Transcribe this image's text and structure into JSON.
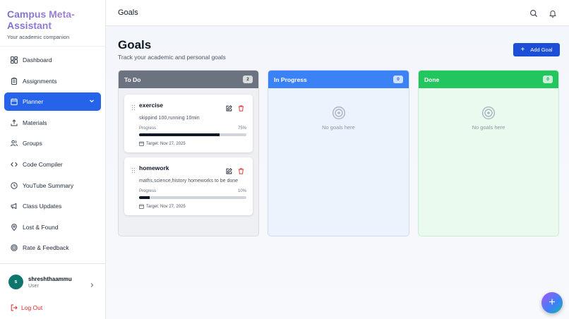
{
  "sidebar": {
    "brand_title": "Campus Meta-Assistant",
    "brand_sub": "Your academic companion",
    "items": [
      {
        "label": "Dashboard",
        "icon": "dashboard-icon"
      },
      {
        "label": "Assignments",
        "icon": "clipboard-icon"
      },
      {
        "label": "Planner",
        "icon": "calendar-icon",
        "active": true
      },
      {
        "label": "Materials",
        "icon": "upload-icon"
      },
      {
        "label": "Groups",
        "icon": "users-icon"
      },
      {
        "label": "Code Compiler",
        "icon": "code-icon"
      },
      {
        "label": "YouTube Summary",
        "icon": "clock-icon"
      },
      {
        "label": "Class Updates",
        "icon": "megaphone-icon"
      },
      {
        "label": "Lost & Found",
        "icon": "map-pin-icon"
      },
      {
        "label": "Rate & Feedback",
        "icon": "target-icon"
      }
    ],
    "user": {
      "initial": "s",
      "name": "shreshthaammu",
      "role": "User"
    },
    "logout_label": "Log Out"
  },
  "header": {
    "title": "Goals"
  },
  "main": {
    "title": "Goals",
    "subtitle": "Track your academic and personal goals",
    "add_button": "Add Goal"
  },
  "columns": {
    "todo": {
      "title": "To Do",
      "count": "2"
    },
    "progress": {
      "title": "In Progress",
      "count": "0",
      "empty": "No goals here"
    },
    "done": {
      "title": "Done",
      "count": "0",
      "empty": "No goals here"
    }
  },
  "goals": [
    {
      "title": "exercise",
      "description": "skippind 100,running 10min",
      "progress_label": "Progress",
      "progress_text": "75%",
      "progress": 0.75,
      "date": "Target: Nov 27, 2025"
    },
    {
      "title": "homework",
      "description": "maths,science,history homeworks to be done",
      "progress_label": "Progress",
      "progress_text": "10%",
      "progress": 0.1,
      "date": "Target: Nov 27, 2025"
    }
  ],
  "colors": {
    "accent": "#2563eb",
    "todo": "#6b7280",
    "progress": "#3b82f6",
    "done": "#22c55e",
    "danger": "#dc2626"
  }
}
